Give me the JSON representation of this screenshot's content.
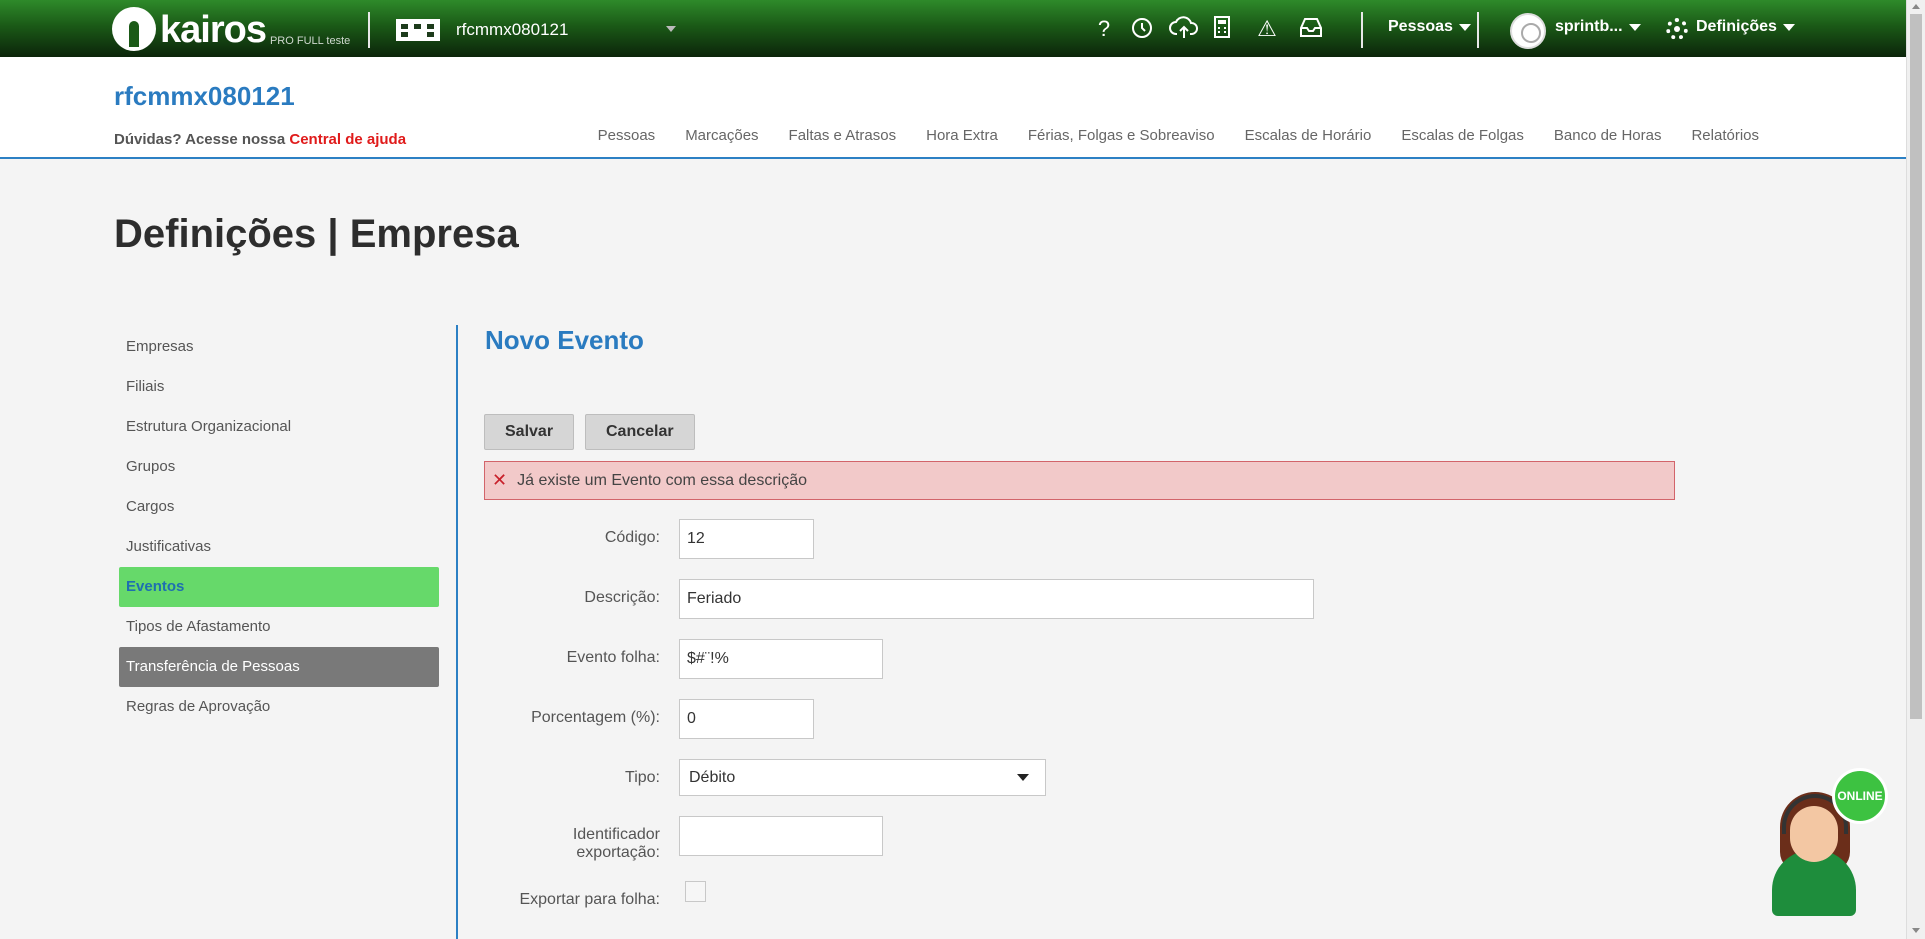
{
  "topbar": {
    "logo_text": "kairos",
    "logo_sub": "PRO FULL teste",
    "company": "rfcmmx080121",
    "icons": [
      "help-icon",
      "clock-icon",
      "cloud-upload-icon",
      "calculator-icon",
      "warning-icon",
      "inbox-icon"
    ],
    "help_glyph": "?",
    "warning_glyph": "⚠",
    "pessoas_label": "Pessoas",
    "user_label": "sprintb...",
    "definicoes_label": "Definições"
  },
  "header": {
    "title": "rfcmmx080121",
    "help_text": "Dúvidas? Acesse nossa ",
    "help_link": "Central de ajuda",
    "nav": [
      "Pessoas",
      "Marcações",
      "Faltas e Atrasos",
      "Hora Extra",
      "Férias, Folgas e Sobreaviso",
      "Escalas de Horário",
      "Escalas de Folgas",
      "Banco de Horas",
      "Relatórios"
    ]
  },
  "page_title": "Definições | Empresa",
  "sidebar": {
    "items": [
      "Empresas",
      "Filiais",
      "Estrutura Organizacional",
      "Grupos",
      "Cargos",
      "Justificativas",
      "Eventos",
      "Tipos de Afastamento",
      "Transferência de Pessoas",
      "Regras de Aprovação"
    ],
    "active": "Eventos"
  },
  "form": {
    "title": "Novo Evento",
    "save_label": "Salvar",
    "cancel_label": "Cancelar",
    "error_message": "Já existe um Evento com essa descrição",
    "codigo_label": "Código:",
    "codigo_value": "12",
    "descricao_label": "Descrição:",
    "descricao_value": "Feriado",
    "evento_folha_label": "Evento folha:",
    "evento_folha_value": "$#¨!%",
    "porcentagem_label": "Porcentagem (%):",
    "porcentagem_value": "0",
    "tipo_label": "Tipo:",
    "tipo_value": "Débito",
    "identificador_label_1": "Identificador",
    "identificador_label_2": "exportação:",
    "identificador_value": "",
    "exportar_label": "Exportar para folha:",
    "exportar_checked": false
  },
  "support": {
    "status": "ONLINE"
  },
  "colors": {
    "accent_blue": "#2a7bc0",
    "active_green": "#66d96a",
    "error_bg": "#f2c9c9",
    "link_red": "#e01b1b"
  }
}
